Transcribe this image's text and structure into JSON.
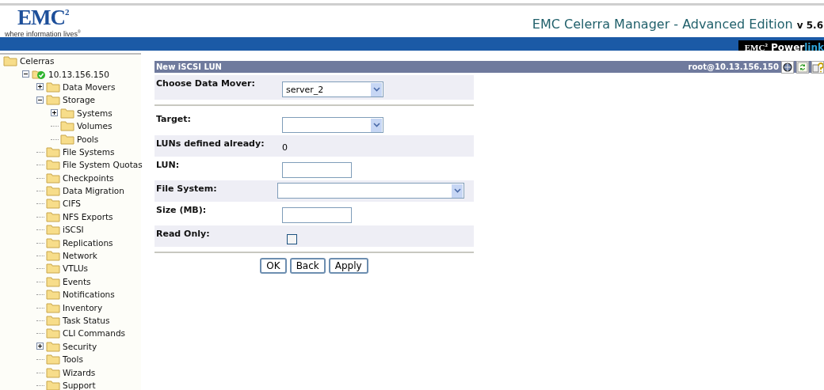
{
  "header": {
    "logo": "EMC",
    "logo_sup": "2",
    "tagline": "where information lives",
    "tagline_mark": "®",
    "title": "EMC Celerra Manager - Advanced Edition",
    "version": "v 5.6",
    "powerlink_brand": "EMC",
    "powerlink_sup": "2",
    "powerlink_a": "Power",
    "powerlink_b": "link"
  },
  "tree": [
    {
      "label": "Celerras",
      "children": [
        {
          "label": "10.13.156.150",
          "expanded": true,
          "children": [
            {
              "label": "Data Movers",
              "expanded": false
            },
            {
              "label": "Storage",
              "expanded": true,
              "children": [
                {
                  "label": "Systems",
                  "expanded": false
                },
                {
                  "label": "Volumes"
                },
                {
                  "label": "Pools"
                }
              ]
            },
            {
              "label": "File Systems"
            },
            {
              "label": "File System Quotas"
            },
            {
              "label": "Checkpoints"
            },
            {
              "label": "Data Migration"
            },
            {
              "label": "CIFS"
            },
            {
              "label": "NFS Exports"
            },
            {
              "label": "iSCSI"
            },
            {
              "label": "Replications"
            },
            {
              "label": "Network"
            },
            {
              "label": "VTLUs"
            },
            {
              "label": "Events"
            },
            {
              "label": "Notifications"
            },
            {
              "label": "Inventory"
            },
            {
              "label": "Task Status"
            },
            {
              "label": "CLI Commands"
            },
            {
              "label": "Security",
              "expanded": false
            },
            {
              "label": "Tools"
            },
            {
              "label": "Wizards"
            },
            {
              "label": "Support"
            }
          ]
        }
      ]
    }
  ],
  "panel": {
    "title": "New iSCSI LUN",
    "user": "root@10.13.156.150"
  },
  "sections": [
    [
      {
        "label": "Choose Data Mover:",
        "kind": "select",
        "value": "server_2"
      }
    ],
    [
      {
        "label": "Target:",
        "kind": "select"
      },
      {
        "label": "LUNs defined already:",
        "kind": "text",
        "value": "0"
      },
      {
        "label": "LUN:",
        "kind": "input"
      },
      {
        "label": "File System:",
        "kind": "wideselect"
      },
      {
        "label": "Size (MB):",
        "kind": "input"
      },
      {
        "label": "Read Only:",
        "kind": "checkbox",
        "checked": false
      }
    ]
  ],
  "buttons": [
    "OK",
    "Back",
    "Apply"
  ]
}
